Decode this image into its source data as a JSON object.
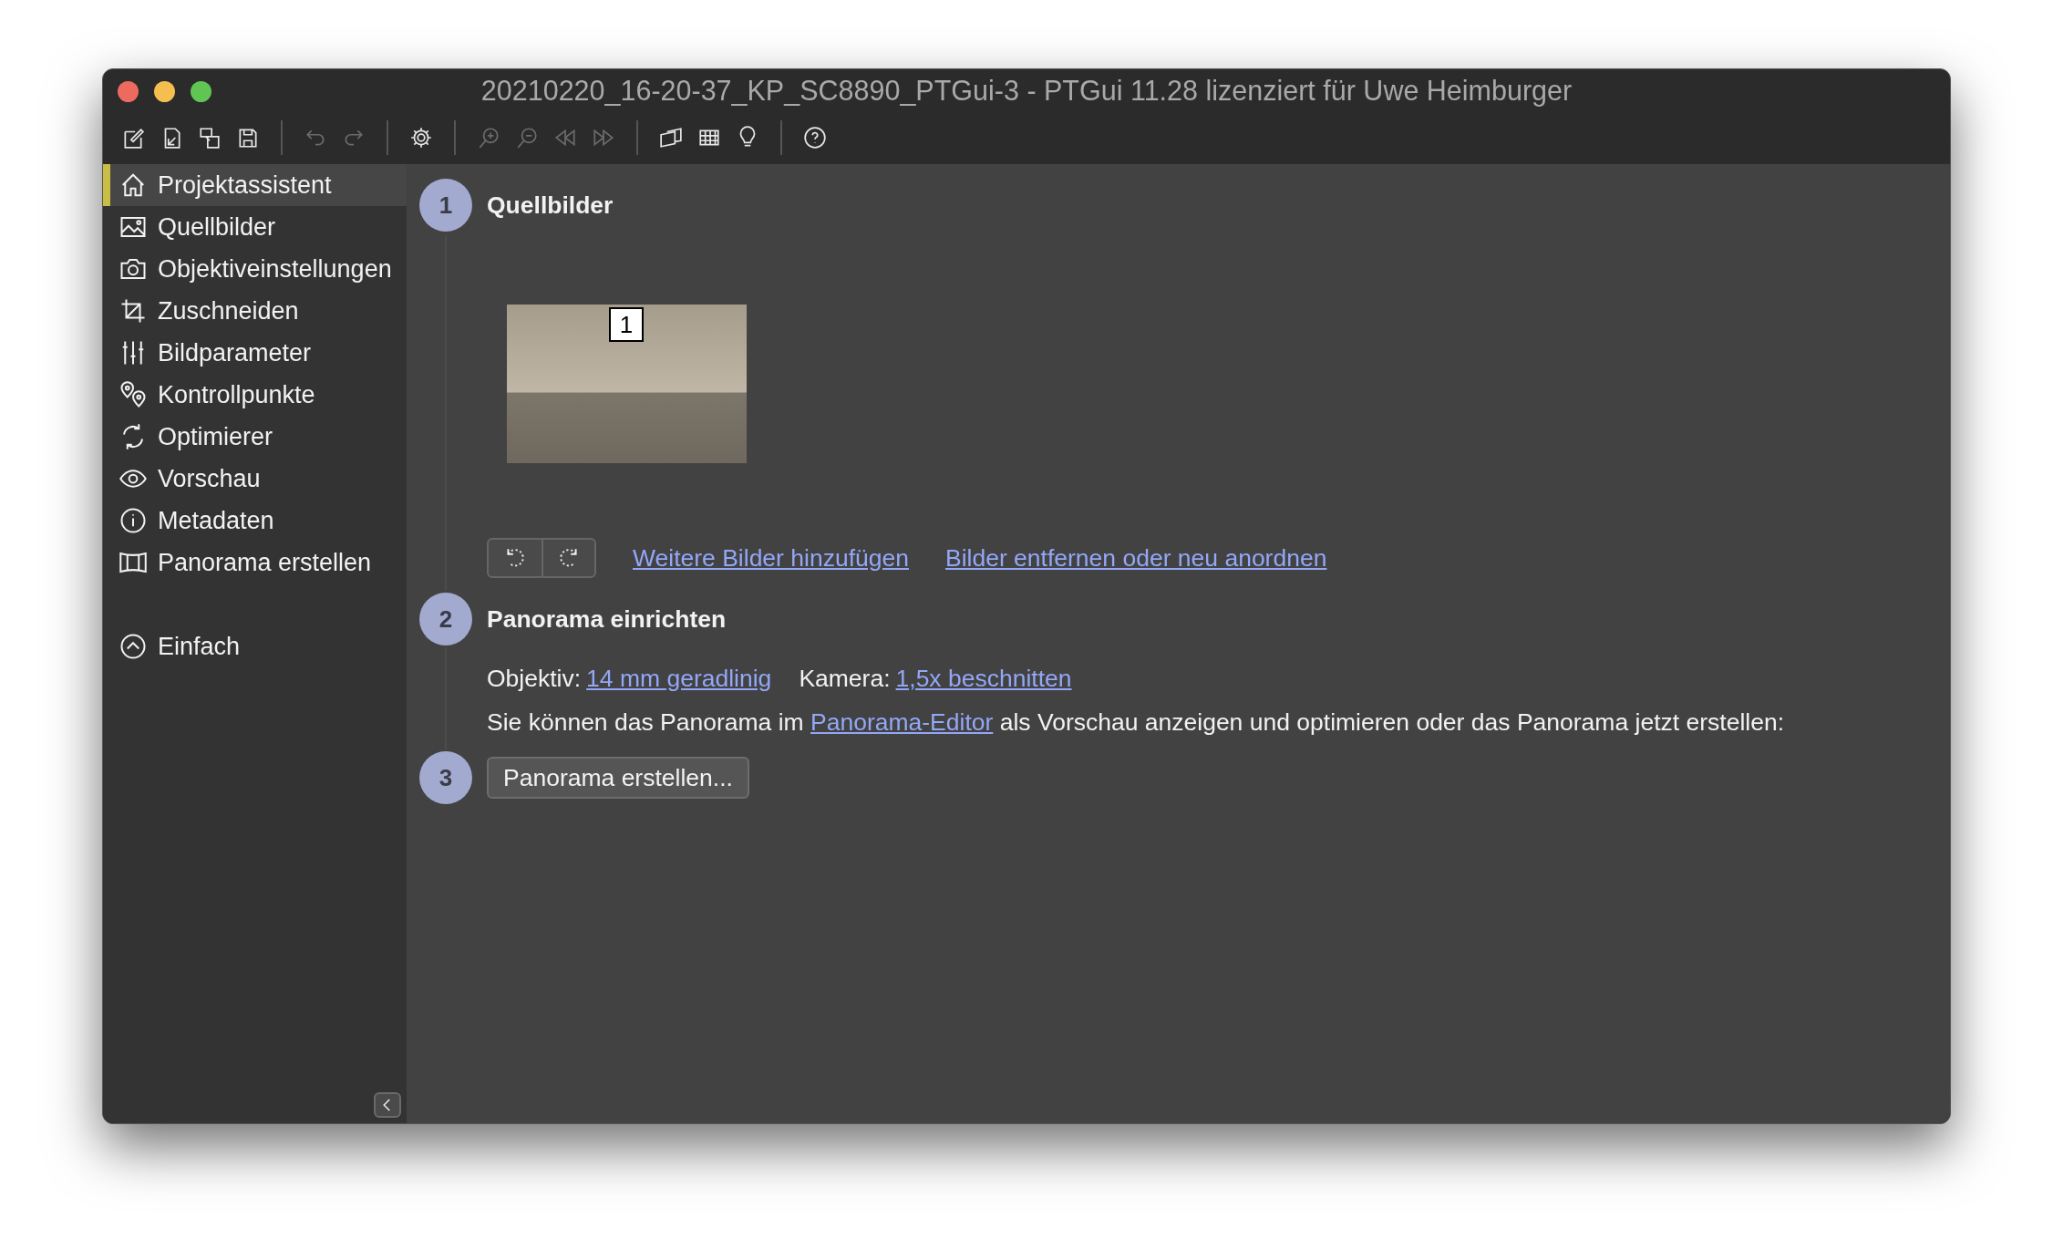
{
  "window": {
    "title": "20210220_16-20-37_KP_SC8890_PTGui-3 - PTGui 11.28 lizenziert für Uwe Heimburger"
  },
  "toolbar": {
    "groups": [
      [
        {
          "disabled": false
        },
        {
          "disabled": false
        },
        {
          "disabled": false
        },
        {
          "disabled": false
        }
      ],
      [
        {
          "disabled": true
        },
        {
          "disabled": true
        }
      ],
      [
        {
          "disabled": false
        }
      ],
      [
        {
          "disabled": true
        },
        {
          "disabled": true
        },
        {
          "disabled": true
        },
        {
          "disabled": true
        }
      ],
      [
        {
          "disabled": false
        },
        {
          "disabled": false
        },
        {
          "disabled": false
        }
      ],
      [
        {
          "disabled": false
        }
      ]
    ]
  },
  "sidebar": {
    "items": [
      {
        "label": "Projektassistent",
        "selected": true
      },
      {
        "label": "Quellbilder",
        "selected": false
      },
      {
        "label": "Objektiveinstellungen",
        "selected": false
      },
      {
        "label": "Zuschneiden",
        "selected": false
      },
      {
        "label": "Bildparameter",
        "selected": false
      },
      {
        "label": "Kontrollpunkte",
        "selected": false
      },
      {
        "label": "Optimierer",
        "selected": false
      },
      {
        "label": "Vorschau",
        "selected": false
      },
      {
        "label": "Metadaten",
        "selected": false
      },
      {
        "label": "Panorama erstellen",
        "selected": false
      }
    ],
    "mode_toggle": {
      "label": "Einfach"
    }
  },
  "source_images": {
    "step": "1",
    "title": "Quellbilder",
    "images": [
      {
        "badge": "1"
      }
    ],
    "links": [
      "Weitere Bilder hinzufügen",
      "Bilder entfernen oder neu anordnen"
    ]
  },
  "setup": {
    "step": "2",
    "title": "Panorama einrichten",
    "lens_label": "Objektiv:",
    "lens_value": "14 mm geradlinig",
    "camera_label": "Kamera:",
    "camera_value": "1,5x beschnitten",
    "sentence": {
      "before": "Sie können das Panorama im",
      "link": "Panorama-Editor",
      "after": "als Vorschau anzeigen und optimieren oder das Panorama jetzt erstellen:"
    }
  },
  "create": {
    "step": "3",
    "button": "Panorama erstellen..."
  }
}
